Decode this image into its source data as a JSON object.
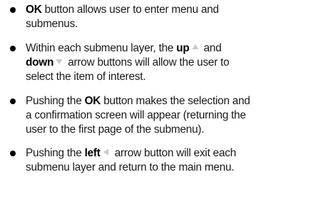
{
  "items": [
    {
      "lines": [
        {
          "b1": "OK",
          "t1": " button allows user to enter menu and"
        },
        {
          "t1": "submenus."
        }
      ]
    },
    {
      "lines": [
        {
          "t1": "Within each submenu layer, the ",
          "b1": "up",
          "t2": " and"
        },
        {
          "b1": "down",
          "t1": " arrow buttons will allow the user to"
        },
        {
          "t1": "select the item of interest."
        }
      ],
      "icons": [
        "up-arrow-icon",
        "down-arrow-icon"
      ]
    },
    {
      "lines": [
        {
          "t1": "Pushing the ",
          "b1": "OK",
          "t2": " button makes the selection and"
        },
        {
          "t1": "a confirmation screen will appear (returning the"
        },
        {
          "t1": "user to the first page of the submenu)."
        }
      ]
    },
    {
      "lines": [
        {
          "t1": "Pushing the ",
          "b1": "left",
          "t2": " arrow button will exit each"
        },
        {
          "t1": "submenu layer and return to the main menu."
        }
      ],
      "icons": [
        "left-arrow-icon"
      ]
    }
  ],
  "colors": {
    "text": "#1a1a1a",
    "bold": "#000000",
    "icon": "#c8c8c8"
  }
}
